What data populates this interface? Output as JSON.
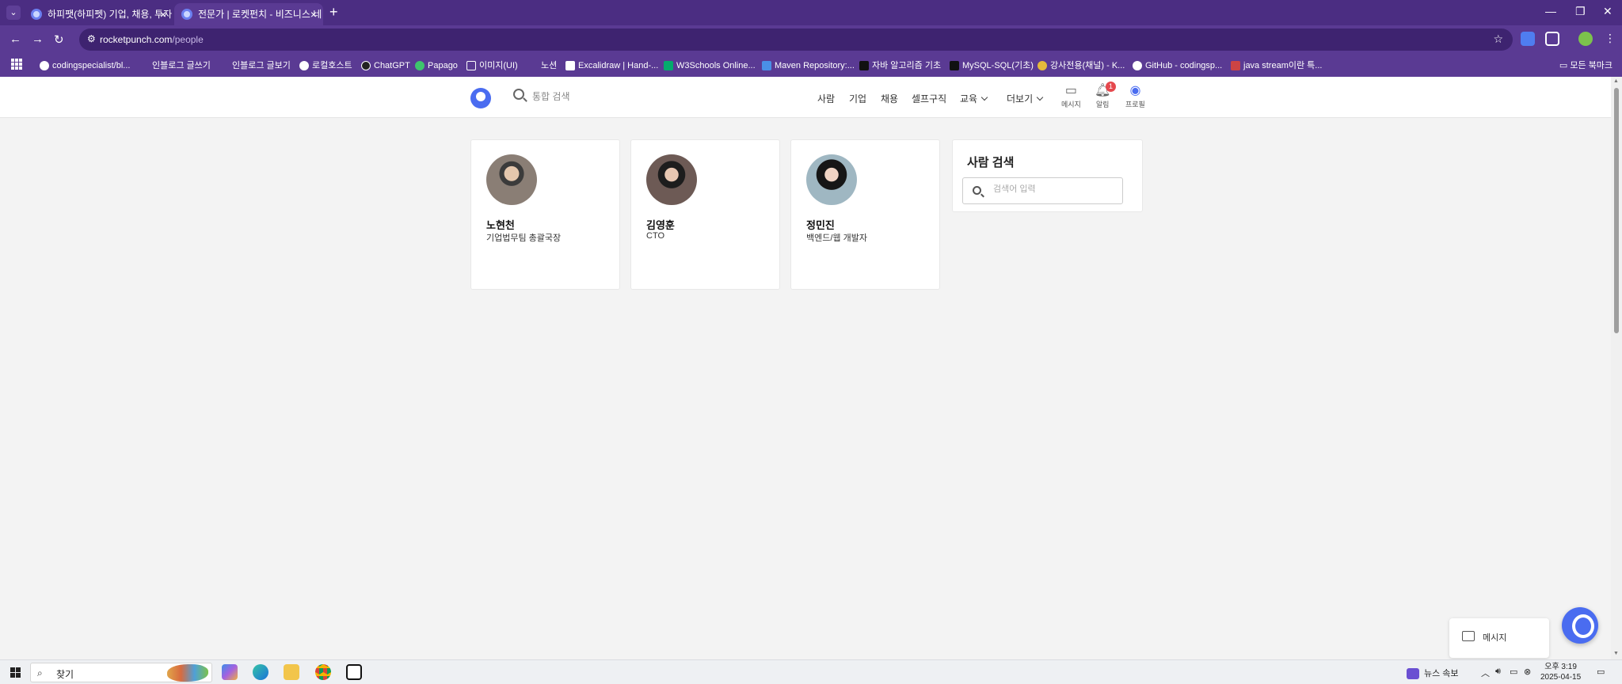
{
  "browser": {
    "tabs": [
      {
        "title": "하피팻(하피펫) 기업, 채용, 투자",
        "active": false
      },
      {
        "title": "전문가 | 로켓펀치 - 비즈니스 네",
        "active": true
      }
    ],
    "url_host": "rocketpunch.com",
    "url_path": "/people",
    "bookmarks": [
      "codingspecialist/bl...",
      "인블로그 글쓰기",
      "인블로그 글보기",
      "로컬호스트",
      "ChatGPT",
      "Papago",
      "이미지(UI)",
      "노션",
      "Excalidraw | Hand-...",
      "W3Schools Online...",
      "Maven Repository:...",
      "자바 알고리즘 기초",
      "MySQL-SQL(기초)",
      "강사전용(채널) - K...",
      "GitHub - codingsp...",
      "java stream이란 특..."
    ],
    "all_bookmarks": "모든 북마크"
  },
  "header": {
    "search_placeholder": "통합 검색",
    "nav": [
      "사람",
      "기업",
      "채용",
      "셀프구직",
      "교육",
      "더보기"
    ],
    "messages_label": "메시지",
    "notifications_label": "알림",
    "notifications_count": "1",
    "profile_label": "프로필"
  },
  "people": [
    {
      "name": "노현천",
      "role": "기업법무팀 총괄국장"
    },
    {
      "name": "김영훈",
      "role": "CTO"
    },
    {
      "name": "정민진",
      "role": "백엔드/웹 개발자"
    }
  ],
  "search_panel": {
    "title": "사람 검색",
    "placeholder": "검색어 입력"
  },
  "message_widget": {
    "label": "메시지"
  },
  "taskbar": {
    "search_label": "찾기",
    "news_label": "뉴스 속보",
    "time": "오후 3:19",
    "date": "2025-04-15"
  },
  "colors": {
    "tabbar": "#4b2d82",
    "toolbar": "#5a3a93",
    "brand": "#4a6cf0",
    "badge": "#e5484d"
  }
}
